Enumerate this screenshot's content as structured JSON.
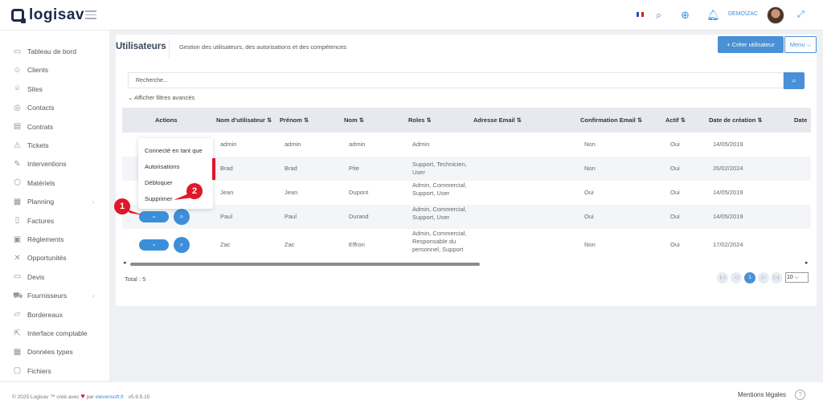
{
  "brand": {
    "name": "logisav"
  },
  "header": {
    "user": "DEMO\\ZAC",
    "icons": [
      "france-flag-icon",
      "search-icon",
      "add-circle-icon",
      "bell-icon",
      "user-icon",
      "avatar",
      "expand-icon"
    ]
  },
  "colors": {
    "primary": "#4a90d6",
    "accent_red": "#e0182a",
    "text": "#555555"
  },
  "sidebar": {
    "items": [
      {
        "label": "Tableau de bord",
        "icon": "dashboard-icon"
      },
      {
        "label": "Clients",
        "icon": "users-icon"
      },
      {
        "label": "Sites",
        "icon": "location-icon"
      },
      {
        "label": "Contacts",
        "icon": "contacts-icon"
      },
      {
        "label": "Contrats",
        "icon": "contract-icon"
      },
      {
        "label": "Tickets",
        "icon": "warning-icon"
      },
      {
        "label": "Interventions",
        "icon": "wrench-icon"
      },
      {
        "label": "Matériels",
        "icon": "box-icon"
      },
      {
        "label": "Planning",
        "icon": "calendar-icon",
        "chevron": "›"
      },
      {
        "label": "Factures",
        "icon": "invoice-icon"
      },
      {
        "label": "Règlements",
        "icon": "payment-icon"
      },
      {
        "label": "Opportunités",
        "icon": "tools-icon"
      },
      {
        "label": "Devis",
        "icon": "quote-icon"
      },
      {
        "label": "Fournisseurs",
        "icon": "truck-icon",
        "chevron": "›"
      },
      {
        "label": "Bordereaux",
        "icon": "slip-icon"
      },
      {
        "label": "Interface comptable",
        "icon": "export-icon"
      },
      {
        "label": "Données types",
        "icon": "data-icon"
      },
      {
        "label": "Fichiers",
        "icon": "folder-icon"
      }
    ]
  },
  "page": {
    "title": "Utilisateurs",
    "subtitle": "Gestion des utilisateurs, des autorisations et des compétences",
    "create_button": "+ Créer utilisateur",
    "menu_button": "Menu ⌵",
    "search_placeholder": "Recherche...",
    "advanced_filters": "⌄  Afficher filtres avancés"
  },
  "table": {
    "columns": [
      "Actions",
      "Nom d'utilisateur ⇅",
      "Prénom ⇅",
      "Nom ⇅",
      "Roles ⇅",
      "Adresse Email ⇅",
      "Confirmation Email ⇅",
      "Actif ⇅",
      "Date de création ⇅",
      "Date"
    ],
    "rows": [
      {
        "username": "admin",
        "firstname": "admin",
        "lastname": "admin",
        "roles": "Admin",
        "confirm": "Non",
        "active": "Oui",
        "created": "14/05/2019"
      },
      {
        "username": "Brad",
        "firstname": "Brad",
        "lastname": "Pite",
        "roles": "Support, Technicien, User",
        "confirm": "Non",
        "active": "Oui",
        "created": "26/02/2024"
      },
      {
        "username": "Jean",
        "firstname": "Jean",
        "lastname": "Dupont",
        "roles": "Admin, Commercial, Support, User",
        "confirm": "Oui",
        "active": "Oui",
        "created": "14/05/2019"
      },
      {
        "username": "Paul",
        "firstname": "Paul",
        "lastname": "Durand",
        "roles": "Admin, Commercial, Support, User",
        "confirm": "Oui",
        "active": "Oui",
        "created": "14/05/2019"
      },
      {
        "username": "Zac",
        "firstname": "Zac",
        "lastname": "Effron",
        "roles": "Admin, Commercial, Responsable du personnel, Support",
        "confirm": "Non",
        "active": "Oui",
        "created": "17/02/2024"
      }
    ],
    "action_label": "⌄",
    "search_label": "⌕"
  },
  "dropdown": {
    "items": [
      "Connecté en tant que",
      "Autorisations",
      "Débloquer",
      "Supprimer"
    ]
  },
  "callouts": [
    "1",
    "2"
  ],
  "pagination": {
    "total": "Total : 5",
    "first": "|◁",
    "prev": "◁",
    "current": "1",
    "next": "▷",
    "last": "▷|",
    "page_size": "10 ⌵"
  },
  "footer": {
    "copyright_before": "© 2025 Logisav ™ créé avec",
    "heart": "♥",
    "by": "par",
    "link": "elevensoft.fr",
    "version": "v5.9.5.15",
    "legal": "Mentions légales",
    "help": "?"
  }
}
